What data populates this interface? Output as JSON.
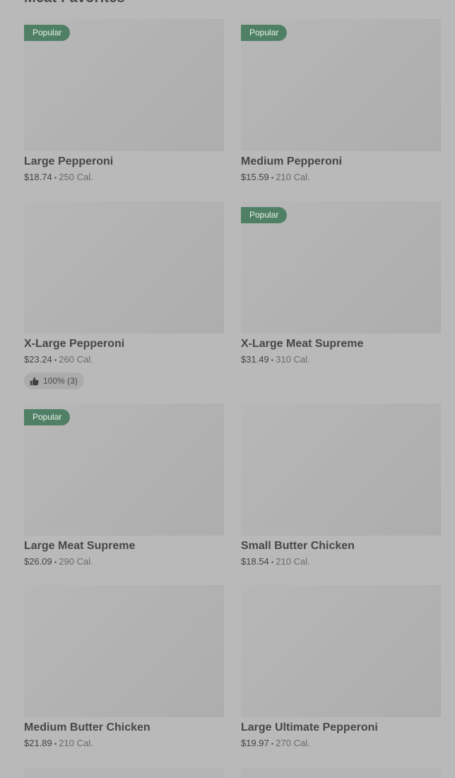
{
  "section": {
    "title": "Meat Favorites"
  },
  "items": [
    {
      "name": "Large Pepperoni",
      "price": "$18.74",
      "calories": "250 Cal.",
      "badge": "Popular"
    },
    {
      "name": "Medium Pepperoni",
      "price": "$15.59",
      "calories": "210 Cal.",
      "badge": "Popular"
    },
    {
      "name": "X-Large Pepperoni",
      "price": "$23.24",
      "calories": "260 Cal.",
      "badge": "",
      "rating": "100% (3)"
    },
    {
      "name": "X-Large Meat Supreme",
      "price": "$31.49",
      "calories": "310 Cal.",
      "badge": "Popular"
    },
    {
      "name": "Large Meat Supreme",
      "price": "$26.09",
      "calories": "290 Cal.",
      "badge": "Popular"
    },
    {
      "name": "Small Butter Chicken",
      "price": "$18.54",
      "calories": "210 Cal.",
      "badge": ""
    },
    {
      "name": "Medium Butter Chicken",
      "price": "$21.89",
      "calories": "210 Cal.",
      "badge": ""
    },
    {
      "name": "Large Ultimate Pepperoni",
      "price": "$19.97",
      "calories": "270 Cal.",
      "badge": ""
    }
  ],
  "separator": "•",
  "icons": {
    "rating": "thumbs-up-icon"
  },
  "colors": {
    "background": "#b9b9b9",
    "badge": "#4f8066",
    "image_placeholder": "#b2b2b2"
  }
}
